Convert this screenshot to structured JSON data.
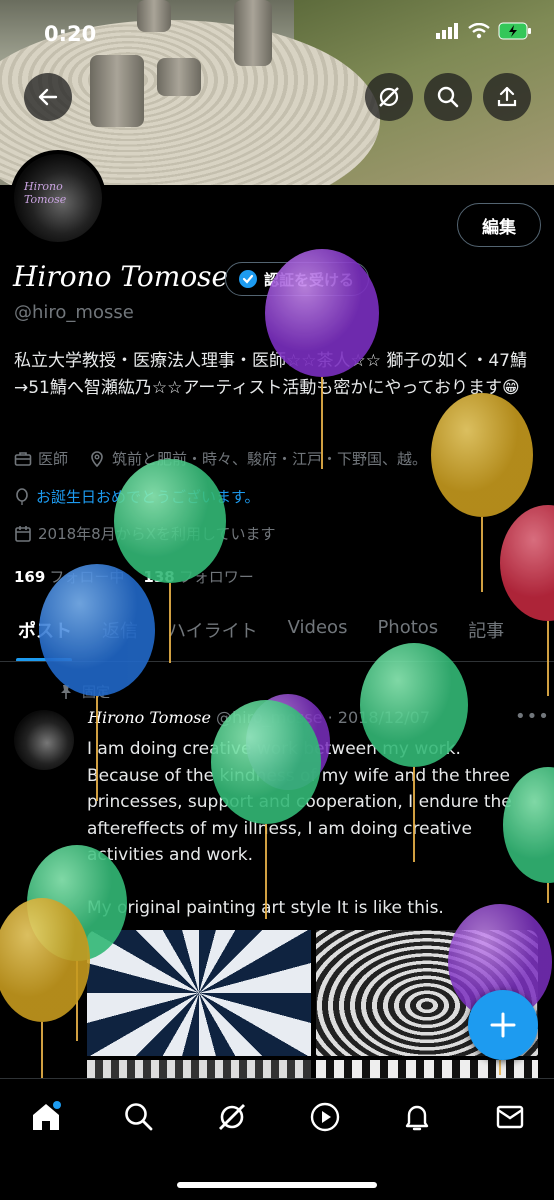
{
  "status_bar": {
    "time": "0:20"
  },
  "profile": {
    "avatar_text": "Hirono Tomose",
    "edit_label": "編集",
    "name": "Hirono Tomose",
    "verify_label": "認証を受ける",
    "handle": "@hiro_mosse",
    "bio": "私立大学教授・医療法人理事・医師☆☆茶人☆☆ 獅子の如く・47鯖 →51鯖へ智瀬紘乃☆☆アーティスト活動も密かにやっております😁",
    "profession": "医師",
    "location": "筑前と肥前・時々、駿府・江戸・下野国、越。",
    "birthday": "お誕生日おめでとうございます。",
    "joined": "2018年8月からXを利用しています",
    "following_count": "169",
    "following_label": "フォロー中",
    "followers_count": "138",
    "followers_label": "フォロワー"
  },
  "tabs": [
    "ポスト",
    "返信",
    "ハイライト",
    "Videos",
    "Photos",
    "記事"
  ],
  "post": {
    "pinned_label": "固定",
    "author_name": "Hirono Tomose",
    "author_handle": "@hiro_mosse",
    "date": "2018/12/07",
    "text": "I am doing creative work between my work. Because of the kindness of my wife and the three princesses, support and cooperation, I endure the aftereffects of my illness, I am doing creative activities and work.\n\nMy original painting art style It is like this."
  },
  "icons": {
    "back": "back-arrow-icon",
    "grok": "grok-icon",
    "search": "search-icon",
    "share": "share-icon",
    "compose": "plus-icon",
    "nav": [
      "home-icon",
      "search-icon",
      "grok-icon",
      "video-icon",
      "bell-icon",
      "mail-icon"
    ]
  },
  "colors": {
    "accent": "#1d9bf0",
    "background": "#000000",
    "muted": "#71767b"
  }
}
